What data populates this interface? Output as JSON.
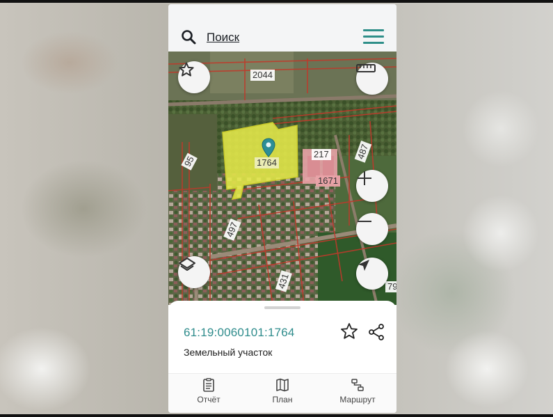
{
  "search": {
    "label": "Поиск"
  },
  "map": {
    "plot_labels": {
      "p2044": "2044",
      "p1764": "1764",
      "p217": "217",
      "p1671": "1671",
      "p95": "95",
      "p487": "487",
      "p497": "497",
      "p431": "431",
      "p79": "79"
    }
  },
  "parcel": {
    "cadastral_number": "61:19:0060101:1764",
    "type": "Земельный участок"
  },
  "tabs": [
    {
      "label": "Отчёт",
      "icon": "report-icon"
    },
    {
      "label": "План",
      "icon": "map-plan-icon"
    },
    {
      "label": "Маршрут",
      "icon": "route-icon"
    }
  ],
  "colors": {
    "accent": "#2f8f89",
    "selected_parcel": "#e5e94a",
    "boundary": "#c0392b",
    "highlight_building": "#e9a3a8"
  }
}
